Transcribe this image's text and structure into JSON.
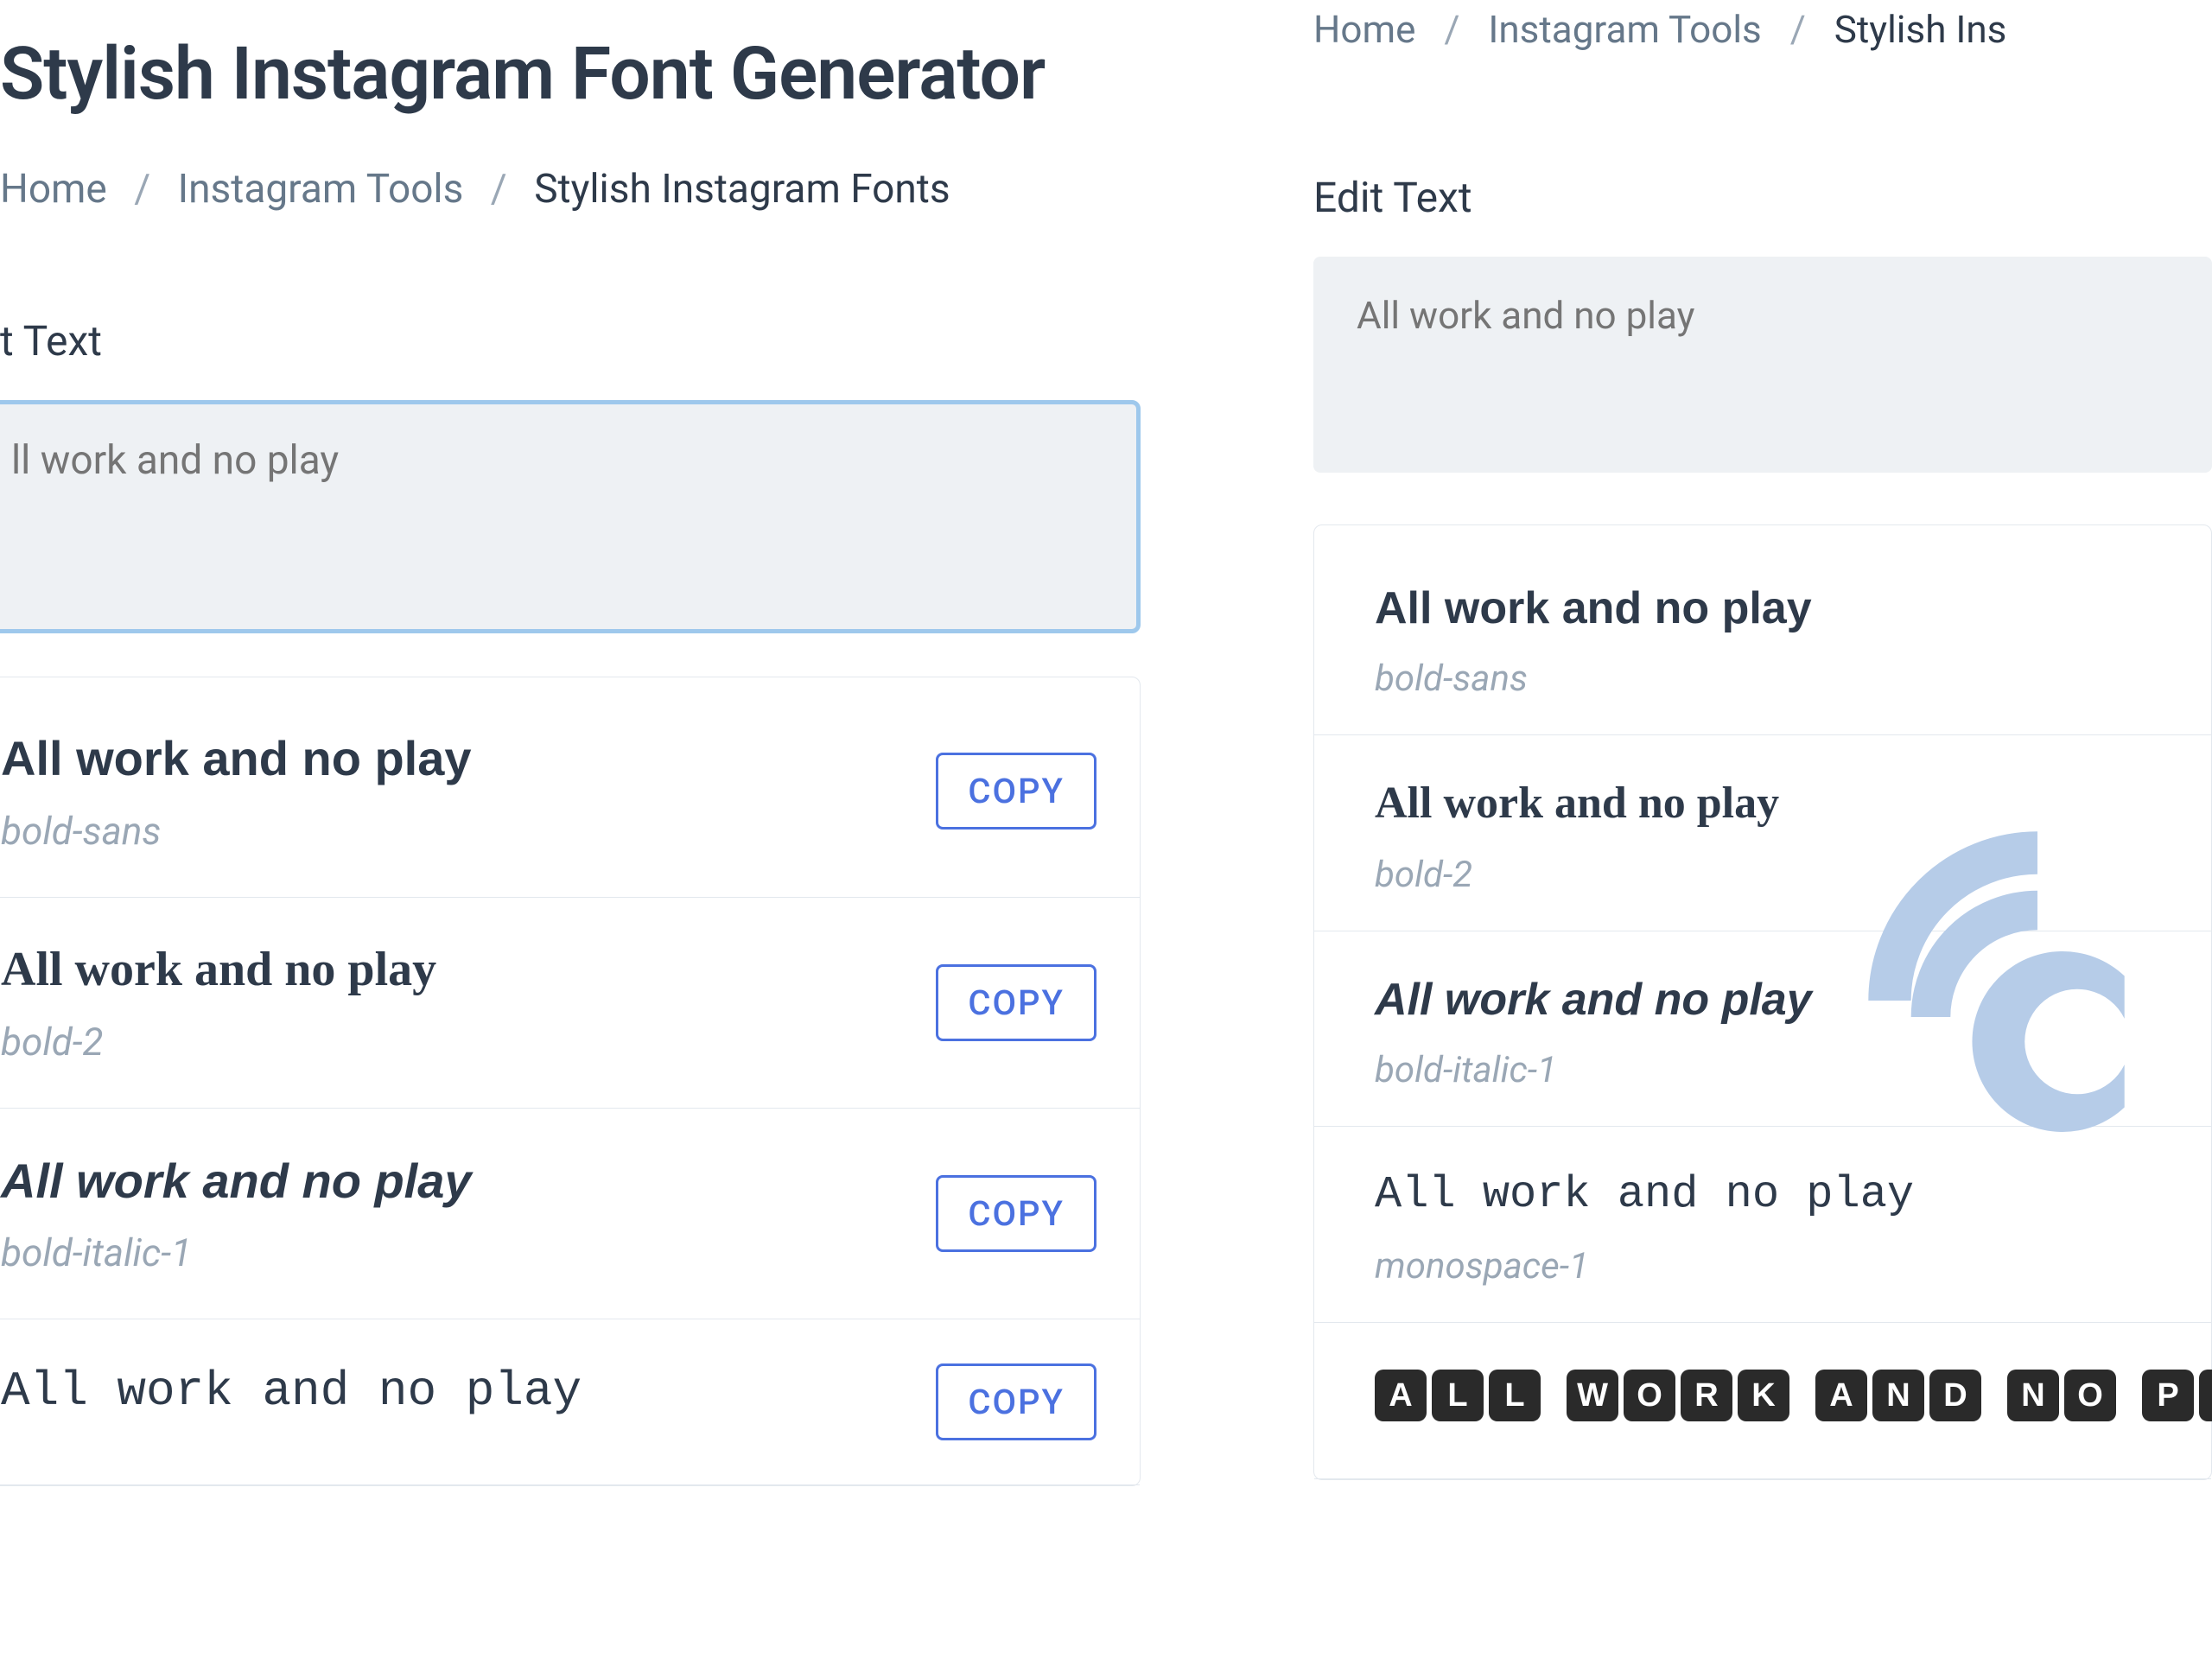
{
  "page": {
    "title": "Stylish Instagram Font Generator"
  },
  "breadcrumb": {
    "home": "Home",
    "tools": "Instagram Tools",
    "current": "Stylish Instagram Fonts",
    "current_truncated": "Stylish Ins"
  },
  "edit": {
    "label": "Edit Text",
    "label_left_clip": "t Text",
    "placeholder_left": "ll work and no play",
    "placeholder_right": "All work and no play"
  },
  "copy_label": "COPY",
  "results_left": [
    {
      "text": "All work and no play",
      "style": "bold-sans",
      "label": "bold-sans"
    },
    {
      "text": "All work and no play",
      "style": "bold-serif",
      "label": "bold-2"
    },
    {
      "text": "All work and no play",
      "style": "bold-italic",
      "label": "bold-italic-1"
    },
    {
      "text": "All work and no play",
      "style": "monospace",
      "label": ""
    }
  ],
  "results_right": [
    {
      "text": "All work and no play",
      "style": "bold-sans",
      "label": "bold-sans"
    },
    {
      "text": "All work and no play",
      "style": "bold-serif",
      "label": "bold-2"
    },
    {
      "text": "All work and no play",
      "style": "bold-italic",
      "label": "bold-italic-1"
    },
    {
      "text": "All work and no play",
      "style": "monospace",
      "label": "monospace-1"
    },
    {
      "text": "ALL WORK AND NO PL",
      "style": "boxed",
      "label": ""
    }
  ],
  "watermark": {
    "color": "#b6cce8"
  }
}
